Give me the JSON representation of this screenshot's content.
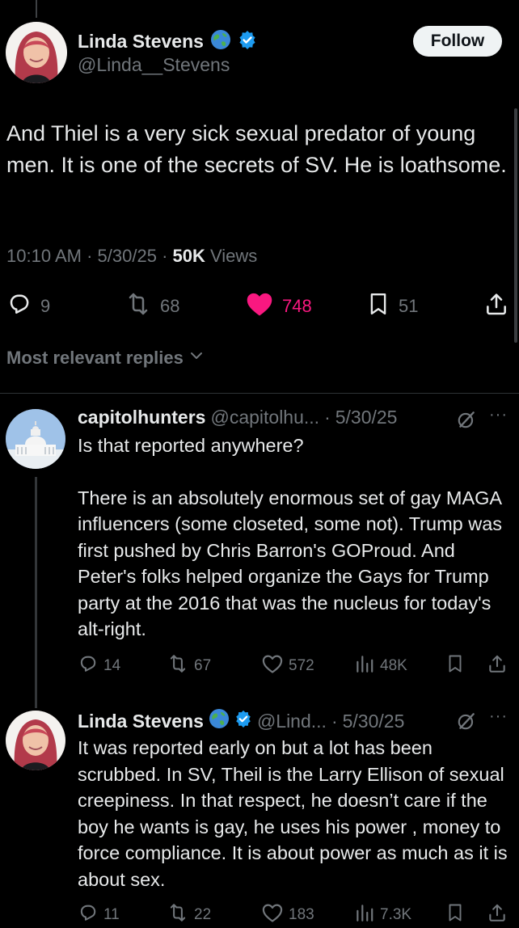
{
  "tweet": {
    "author_name": "Linda Stevens",
    "author_handle": "@Linda__Stevens",
    "follow_label": "Follow",
    "text": "And Thiel is a very sick sexual predator of young men. It is one of the secrets of SV. He is loathsome.",
    "time": "10:10 AM",
    "date": "5/30/25",
    "views_count": "50K",
    "views_label": "Views",
    "replies": "9",
    "reposts": "68",
    "likes": "748",
    "bookmarks": "51"
  },
  "replies_sort_label": "Most relevant replies",
  "replies": [
    {
      "author_name": "capitolhunters",
      "author_handle": "@capitolhu...",
      "date": "5/30/25",
      "para1": "Is that reported anywhere?",
      "para2": "There is an absolutely enormous set of gay MAGA influencers (some closeted, some not). Trump was first pushed by Chris Barron's GOProud. And Peter's folks helped organize the Gays for Trump party at the 2016 that was the nucleus for today's alt-right.",
      "replies": "14",
      "reposts": "67",
      "likes": "572",
      "views": "48K"
    },
    {
      "author_name": "Linda Stevens",
      "author_handle": "@Lind...",
      "date": "5/30/25",
      "para1": "It was reported early on but a lot has been scrubbed. In SV, Theil is the Larry Ellison of sexual creepiness. In that respect, he doesn’t care if the boy he wants is gay, he uses his power , money to force compliance. It is about power as much as it is about sex.",
      "replies": "11",
      "reposts": "22",
      "likes": "183",
      "views": "7.3K"
    }
  ],
  "colors": {
    "background": "#000000",
    "text": "#e7e9ea",
    "muted": "#71767b",
    "like_active": "#f91880",
    "verified": "#1d9bf0"
  }
}
